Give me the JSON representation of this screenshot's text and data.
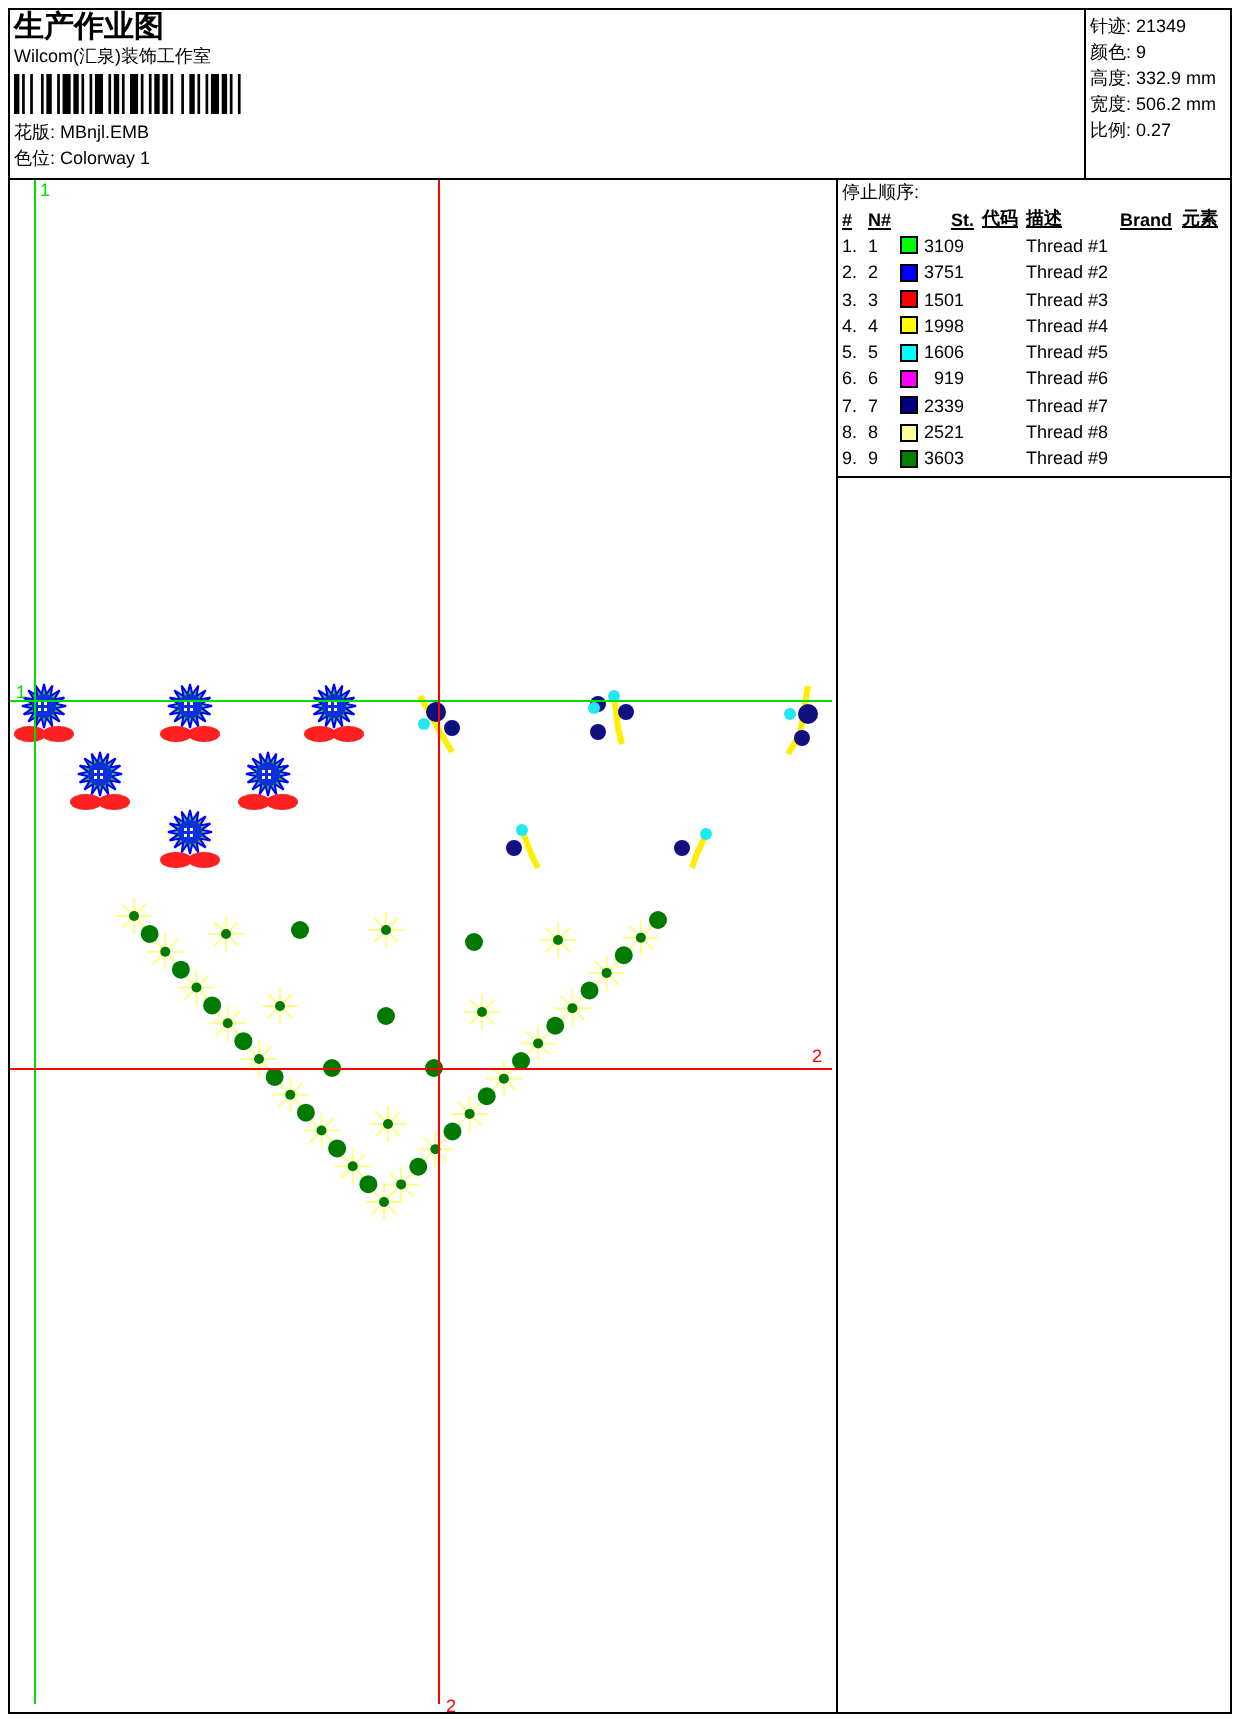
{
  "header": {
    "title": "生产作业图",
    "studio": "Wilcom(汇泉)装饰工作室",
    "fields": [
      {
        "label": "花版:",
        "value": "MBnjl.EMB"
      },
      {
        "label": "色位:",
        "value": "Colorway 1"
      }
    ]
  },
  "stats": [
    {
      "label": "针迹:",
      "value": "21349"
    },
    {
      "label": "颜色:",
      "value": "9"
    },
    {
      "label": "高度:",
      "value": "332.9 mm"
    },
    {
      "label": "宽度:",
      "value": "506.2 mm"
    },
    {
      "label": "比例:",
      "value": "0.27"
    }
  ],
  "guides": [
    {
      "color": "#00dd00",
      "labels": [
        "1",
        "1"
      ]
    },
    {
      "color": "#ff0000",
      "labels": [
        "2",
        "2"
      ]
    }
  ],
  "stop_sequence": {
    "title": "停止顺序:",
    "columns": [
      "#",
      "N#",
      "St.",
      "代码",
      "描述",
      "Brand",
      "元素"
    ],
    "rows": [
      {
        "order": "1.",
        "needle": "1",
        "color": "#00ff00",
        "stitches": "3109",
        "description": "Thread #1"
      },
      {
        "order": "2.",
        "needle": "2",
        "color": "#0000ff",
        "stitches": "3751",
        "description": "Thread #2"
      },
      {
        "order": "3.",
        "needle": "3",
        "color": "#ff0000",
        "stitches": "1501",
        "description": "Thread #3"
      },
      {
        "order": "4.",
        "needle": "4",
        "color": "#ffff00",
        "stitches": "1998",
        "description": "Thread #4"
      },
      {
        "order": "5.",
        "needle": "5",
        "color": "#00ffff",
        "stitches": "1606",
        "description": "Thread #5"
      },
      {
        "order": "6.",
        "needle": "6",
        "color": "#ff00ff",
        "stitches": "919",
        "description": "Thread #6"
      },
      {
        "order": "7.",
        "needle": "7",
        "color": "#000080",
        "stitches": "2339",
        "description": "Thread #7"
      },
      {
        "order": "8.",
        "needle": "8",
        "color": "#ffff99",
        "stitches": "2521",
        "description": "Thread #8"
      },
      {
        "order": "9.",
        "needle": "9",
        "color": "#008000",
        "stitches": "3603",
        "description": "Thread #9"
      }
    ]
  }
}
